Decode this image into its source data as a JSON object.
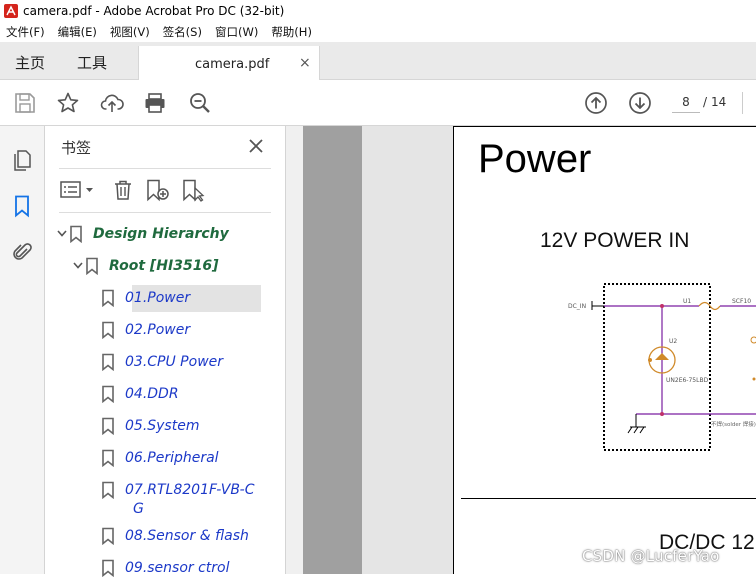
{
  "window": {
    "title": "camera.pdf - Adobe Acrobat Pro DC (32-bit)"
  },
  "menu": [
    "文件(F)",
    "编辑(E)",
    "视图(V)",
    "签名(S)",
    "窗口(W)",
    "帮助(H)"
  ],
  "tabs": {
    "home": "主页",
    "tools": "工具",
    "document": "camera.pdf",
    "close_glyph": "×"
  },
  "toolbar": {
    "icons": [
      "save-icon",
      "star-icon",
      "upload-icon",
      "print-icon",
      "zoom-icon",
      "page-up-icon",
      "page-down-icon"
    ],
    "page_current": "8",
    "page_total": "14",
    "page_sep": "/"
  },
  "panel": {
    "title": "书签",
    "close_glyph": "✕",
    "bookmarks": [
      {
        "label": "Design Hierarchy",
        "level": 0
      },
      {
        "label": "Root [HI3516]",
        "level": 1
      },
      {
        "label": "01.Power",
        "level": 2,
        "selected": true
      },
      {
        "label": "02.Power",
        "level": 2
      },
      {
        "label": "03.CPU Power",
        "level": 2
      },
      {
        "label": "04.DDR",
        "level": 2
      },
      {
        "label": "05.System",
        "level": 2
      },
      {
        "label": "06.Peripheral",
        "level": 2
      },
      {
        "label": "07.RTL8201F-VB-C",
        "label2": "G",
        "level": 2
      },
      {
        "label": "08.Sensor  & flash",
        "level": 2
      },
      {
        "label": "09.sensor ctrol",
        "level": 2
      }
    ]
  },
  "document": {
    "heading": "Power",
    "section1": "12V POWER IN",
    "section2": "DC/DC 12",
    "schematic": {
      "net_dc_in": "DC_IN",
      "u1": "U1",
      "scf": "SCF10",
      "u2": "U2",
      "part": "UN2E6-75LBD",
      "solder": "不焊(solder 焊接)"
    }
  },
  "watermark": "CSDN @LucferYao",
  "colors": {
    "bookmark_group": "#1f6a3e",
    "bookmark_link": "#1c39c8",
    "wire": "#7a1fa0",
    "net": "#c0306a",
    "component": "#d08a2a"
  }
}
